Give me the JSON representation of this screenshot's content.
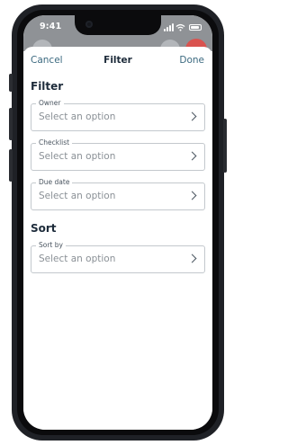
{
  "status_bar": {
    "time": "9:41"
  },
  "sheet": {
    "cancel_label": "Cancel",
    "title": "Filter",
    "done_label": "Done"
  },
  "filter_section": {
    "heading": "Filter",
    "fields": [
      {
        "label": "Owner",
        "value": "Select an option"
      },
      {
        "label": "Checklist",
        "value": "Select an option"
      },
      {
        "label": "Due date",
        "value": "Select an option"
      }
    ]
  },
  "sort_section": {
    "heading": "Sort",
    "fields": [
      {
        "label": "Sort by",
        "value": "Select an option"
      }
    ]
  },
  "colors": {
    "accent": "#3c6a80",
    "heading": "#1d2b3a",
    "placeholder": "#8a9096",
    "border": "#c3c8cd"
  }
}
